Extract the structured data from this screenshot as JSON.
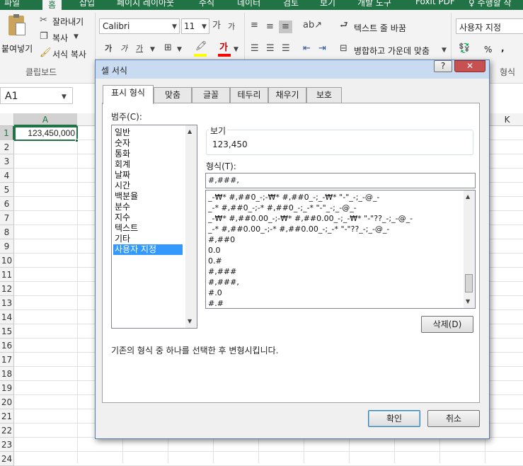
{
  "ribbon_tabs": [
    "파일",
    "홈",
    "삽입",
    "페이지 레이아웃",
    "수식",
    "데이터",
    "검토",
    "보기",
    "개발 도구",
    "Foxit PDF",
    "♀ 수행할 작"
  ],
  "clipboard": {
    "paste": "붙여넣기",
    "cut": "잘라내기",
    "copy": "복사",
    "format_painter": "서식 복사",
    "group": "클립보드"
  },
  "font": {
    "name": "Calibri",
    "size": "11",
    "grow": "가",
    "shrink": "가",
    "bold": "가",
    "italic": "가",
    "underline": "가",
    "fill_glyph": "가"
  },
  "alignment": {
    "wrap": "텍스트 줄 바꿈",
    "merge": "병합하고 가운데 맞춤"
  },
  "number": {
    "format": "사용자 지정",
    "percent": "%",
    "comma": ","
  },
  "right_group_label": "형식",
  "name_box": "A1",
  "columns": {
    "a": "A",
    "k": "K"
  },
  "rows": [
    "1",
    "2",
    "3",
    "4",
    "5",
    "6",
    "7",
    "8",
    "9",
    "10",
    "11",
    "12",
    "13",
    "14",
    "15",
    "16",
    "17",
    "18",
    "19",
    "20",
    "21",
    "22",
    "23",
    "24"
  ],
  "cell_a1": "123,450,000",
  "dialog": {
    "title": "셀 서식",
    "help": "?",
    "tabs": [
      "표시 형식",
      "맞춤",
      "글꼴",
      "테두리",
      "채우기",
      "보호"
    ],
    "category_label": "범주(C):",
    "categories": [
      "일반",
      "숫자",
      "통화",
      "회계",
      "날짜",
      "시간",
      "백분율",
      "분수",
      "지수",
      "텍스트",
      "기타",
      "사용자 지정"
    ],
    "selected_category": 11,
    "sample_label": "보기",
    "sample_value": "123,450",
    "type_label": "형식(T):",
    "type_value": "#,###,",
    "format_codes": [
      "_-₩* #,##0_-;-₩* #,##0_-;_-₩* \"-\"_-;_-@_-",
      "_-* #,##0_-;-* #,##0_-;_-* \"-\"_-;_-@_-",
      "_-₩* #,##0.00_-;-₩* #,##0.00_-;_-₩* \"-\"??_-;_-@_-",
      "_-* #,##0.00_-;-* #,##0.00_-;_-* \"-\"??_-;_-@_-",
      "#,##0",
      "0.0",
      "0.#",
      "#,###",
      "#,###,",
      "#.0",
      "#.#"
    ],
    "delete_button": "삭제(D)",
    "description": "기존의 형식 중 하나를 선택한 후 변형시킵니다.",
    "ok": "확인",
    "cancel": "취소"
  }
}
